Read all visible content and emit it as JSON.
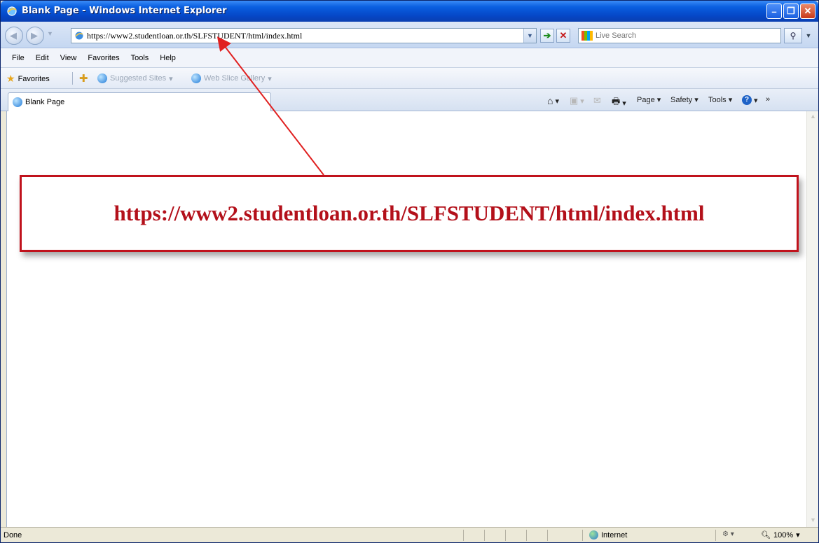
{
  "window": {
    "title": "Blank Page - Windows Internet Explorer"
  },
  "address": {
    "url": "https://www2.studentloan.or.th/SLFSTUDENT/html/index.html"
  },
  "search": {
    "placeholder": "Live Search"
  },
  "menu": {
    "items": [
      "File",
      "Edit",
      "View",
      "Favorites",
      "Tools",
      "Help"
    ]
  },
  "favorites_bar": {
    "favorites_label": "Favorites",
    "suggested_sites": "Suggested Sites",
    "web_slice_gallery": "Web Slice Gallery"
  },
  "tabs": {
    "active_label": "Blank Page"
  },
  "command_bar": {
    "page": "Page",
    "safety": "Safety",
    "tools": "Tools"
  },
  "annotation": {
    "url_text": "https://www2.studentloan.or.th/SLFSTUDENT/html/index.html",
    "color": "#b3101a"
  },
  "status": {
    "text": "Done",
    "zone": "Internet",
    "zoom": "100%"
  }
}
